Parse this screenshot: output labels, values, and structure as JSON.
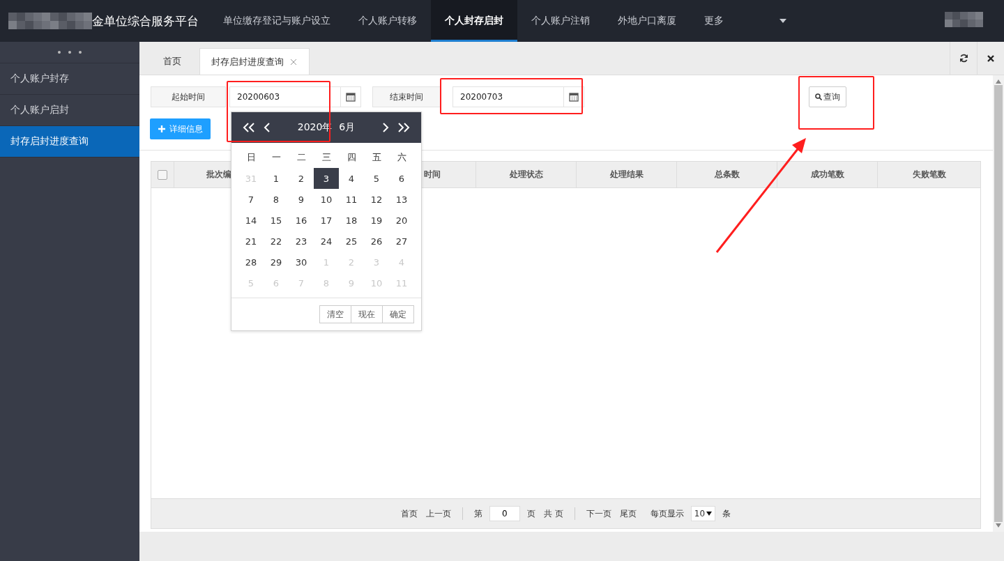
{
  "header": {
    "brand": "金单位综合服务平台",
    "nav": [
      {
        "label": "单位缴存登记与账户设立",
        "selected": false
      },
      {
        "label": "个人账户转移",
        "selected": false
      },
      {
        "label": "个人封存启封",
        "selected": true
      },
      {
        "label": "个人账户注销",
        "selected": false
      },
      {
        "label": "外地户口离厦",
        "selected": false
      },
      {
        "label": "更多",
        "selected": false
      }
    ]
  },
  "sidebar": {
    "items": [
      {
        "label": "个人账户封存",
        "selected": false
      },
      {
        "label": "个人账户启封",
        "selected": false
      },
      {
        "label": "封存启封进度查询",
        "selected": true
      }
    ]
  },
  "tabs": [
    {
      "label": "首页",
      "selected": false,
      "closable": false
    },
    {
      "label": "封存启封进度查询",
      "selected": true,
      "closable": true
    }
  ],
  "form": {
    "start_label": "起始时间",
    "start_value": "20200603",
    "end_label": "结束时间",
    "end_value": "20200703",
    "search_button": "查询",
    "detail_button": "详细信息"
  },
  "table": {
    "columns": [
      {
        "label": "批次编"
      },
      {},
      {
        "label": "时间"
      },
      {
        "label": "处理状态"
      },
      {
        "label": "处理结果"
      },
      {
        "label": "总条数"
      },
      {
        "label": "成功笔数"
      },
      {
        "label": "失败笔数"
      }
    ],
    "select_all_checked": false
  },
  "pagination": {
    "first": "首页",
    "prev": "上一页",
    "page_prefix": "第",
    "page_value": "0",
    "page_suffix": "页",
    "total": "共 页",
    "next": "下一页",
    "last": "尾页",
    "per_page_label": "每页显示",
    "per_page_value": "10",
    "per_page_suffix": "条"
  },
  "datepicker": {
    "year": "2020年",
    "month": "6月",
    "weekdays": [
      "日",
      "一",
      "二",
      "三",
      "四",
      "五",
      "六"
    ],
    "weeks": [
      [
        {
          "d": "31",
          "muted": true,
          "selected": false
        },
        {
          "d": "1",
          "muted": false,
          "selected": false
        },
        {
          "d": "2",
          "muted": false,
          "selected": false
        },
        {
          "d": "3",
          "muted": false,
          "selected": true
        },
        {
          "d": "4",
          "muted": false,
          "selected": false
        },
        {
          "d": "5",
          "muted": false,
          "selected": false
        },
        {
          "d": "6",
          "muted": false,
          "selected": false
        }
      ],
      [
        {
          "d": "7",
          "muted": false,
          "selected": false
        },
        {
          "d": "8",
          "muted": false,
          "selected": false
        },
        {
          "d": "9",
          "muted": false,
          "selected": false
        },
        {
          "d": "10",
          "muted": false,
          "selected": false
        },
        {
          "d": "11",
          "muted": false,
          "selected": false
        },
        {
          "d": "12",
          "muted": false,
          "selected": false
        },
        {
          "d": "13",
          "muted": false,
          "selected": false
        }
      ],
      [
        {
          "d": "14",
          "muted": false,
          "selected": false
        },
        {
          "d": "15",
          "muted": false,
          "selected": false
        },
        {
          "d": "16",
          "muted": false,
          "selected": false
        },
        {
          "d": "17",
          "muted": false,
          "selected": false
        },
        {
          "d": "18",
          "muted": false,
          "selected": false
        },
        {
          "d": "19",
          "muted": false,
          "selected": false
        },
        {
          "d": "20",
          "muted": false,
          "selected": false
        }
      ],
      [
        {
          "d": "21",
          "muted": false,
          "selected": false
        },
        {
          "d": "22",
          "muted": false,
          "selected": false
        },
        {
          "d": "23",
          "muted": false,
          "selected": false
        },
        {
          "d": "24",
          "muted": false,
          "selected": false
        },
        {
          "d": "25",
          "muted": false,
          "selected": false
        },
        {
          "d": "26",
          "muted": false,
          "selected": false
        },
        {
          "d": "27",
          "muted": false,
          "selected": false
        }
      ],
      [
        {
          "d": "28",
          "muted": false,
          "selected": false
        },
        {
          "d": "29",
          "muted": false,
          "selected": false
        },
        {
          "d": "30",
          "muted": false,
          "selected": false
        },
        {
          "d": "1",
          "muted": true,
          "selected": false
        },
        {
          "d": "2",
          "muted": true,
          "selected": false
        },
        {
          "d": "3",
          "muted": true,
          "selected": false
        },
        {
          "d": "4",
          "muted": true,
          "selected": false
        }
      ],
      [
        {
          "d": "5",
          "muted": true,
          "selected": false
        },
        {
          "d": "6",
          "muted": true,
          "selected": false
        },
        {
          "d": "7",
          "muted": true,
          "selected": false
        },
        {
          "d": "8",
          "muted": true,
          "selected": false
        },
        {
          "d": "9",
          "muted": true,
          "selected": false
        },
        {
          "d": "10",
          "muted": true,
          "selected": false
        },
        {
          "d": "11",
          "muted": true,
          "selected": false
        }
      ]
    ],
    "buttons": [
      "清空",
      "现在",
      "确定"
    ]
  }
}
